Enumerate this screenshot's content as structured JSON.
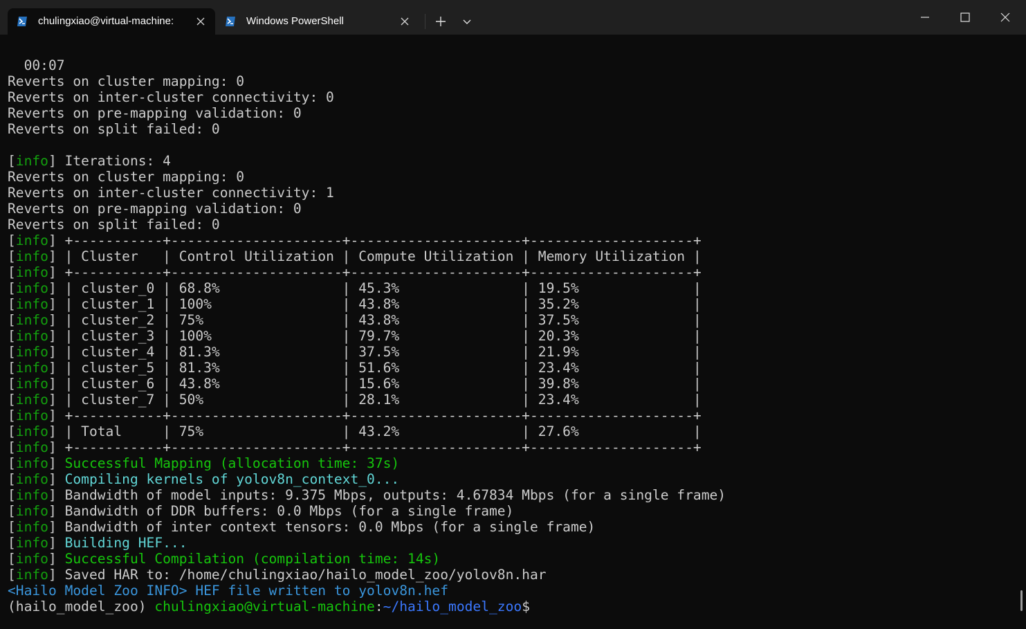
{
  "tabs": [
    {
      "title": "chulingxiao@virtual-machine:"
    },
    {
      "title": "Windows PowerShell"
    }
  ],
  "icons": {
    "tab_icon": "powershell-icon",
    "tab_close": "close-icon",
    "new_tab": "plus-icon",
    "dropdown": "chevron-down-icon",
    "minimize": "minimize-icon",
    "maximize": "maximize-icon",
    "close_window": "close-icon"
  },
  "colors": {
    "background": "#0c0c0c",
    "titlebar": "#202020",
    "info_tag": "#13a10e",
    "success": "#16c60c",
    "cyan": "#61d6d6",
    "blue": "#3b78ff"
  },
  "terminal": {
    "lines": [
      [
        {
          "t": "  00:07"
        }
      ],
      [
        {
          "t": "Reverts on cluster mapping: 0"
        }
      ],
      [
        {
          "t": "Reverts on inter-cluster connectivity: 0"
        }
      ],
      [
        {
          "t": "Reverts on pre-mapping validation: 0"
        }
      ],
      [
        {
          "t": "Reverts on split failed: 0"
        }
      ],
      [
        {
          "t": ""
        }
      ],
      [
        {
          "t": "["
        },
        {
          "t": "info",
          "c": "g"
        },
        {
          "t": "] Iterations: 4"
        }
      ],
      [
        {
          "t": "Reverts on cluster mapping: 0"
        }
      ],
      [
        {
          "t": "Reverts on inter-cluster connectivity: 1"
        }
      ],
      [
        {
          "t": "Reverts on pre-mapping validation: 0"
        }
      ],
      [
        {
          "t": "Reverts on split failed: 0"
        }
      ],
      [
        {
          "t": "["
        },
        {
          "t": "info",
          "c": "g"
        },
        {
          "t": "] +-----------+---------------------+---------------------+--------------------+"
        }
      ],
      [
        {
          "t": "["
        },
        {
          "t": "info",
          "c": "g"
        },
        {
          "t": "] | Cluster   | Control Utilization | Compute Utilization | Memory Utilization |"
        }
      ],
      [
        {
          "t": "["
        },
        {
          "t": "info",
          "c": "g"
        },
        {
          "t": "] +-----------+---------------------+---------------------+--------------------+"
        }
      ],
      [
        {
          "t": "["
        },
        {
          "t": "info",
          "c": "g"
        },
        {
          "t": "] | cluster_0 | 68.8%               | 45.3%               | 19.5%              |"
        }
      ],
      [
        {
          "t": "["
        },
        {
          "t": "info",
          "c": "g"
        },
        {
          "t": "] | cluster_1 | 100%                | 43.8%               | 35.2%              |"
        }
      ],
      [
        {
          "t": "["
        },
        {
          "t": "info",
          "c": "g"
        },
        {
          "t": "] | cluster_2 | 75%                 | 43.8%               | 37.5%              |"
        }
      ],
      [
        {
          "t": "["
        },
        {
          "t": "info",
          "c": "g"
        },
        {
          "t": "] | cluster_3 | 100%                | 79.7%               | 20.3%              |"
        }
      ],
      [
        {
          "t": "["
        },
        {
          "t": "info",
          "c": "g"
        },
        {
          "t": "] | cluster_4 | 81.3%               | 37.5%               | 21.9%              |"
        }
      ],
      [
        {
          "t": "["
        },
        {
          "t": "info",
          "c": "g"
        },
        {
          "t": "] | cluster_5 | 81.3%               | 51.6%               | 23.4%              |"
        }
      ],
      [
        {
          "t": "["
        },
        {
          "t": "info",
          "c": "g"
        },
        {
          "t": "] | cluster_6 | 43.8%               | 15.6%               | 39.8%              |"
        }
      ],
      [
        {
          "t": "["
        },
        {
          "t": "info",
          "c": "g"
        },
        {
          "t": "] | cluster_7 | 50%                 | 28.1%               | 23.4%              |"
        }
      ],
      [
        {
          "t": "["
        },
        {
          "t": "info",
          "c": "g"
        },
        {
          "t": "] +-----------+---------------------+---------------------+--------------------+"
        }
      ],
      [
        {
          "t": "["
        },
        {
          "t": "info",
          "c": "g"
        },
        {
          "t": "] | Total     | 75%                 | 43.2%               | 27.6%              |"
        }
      ],
      [
        {
          "t": "["
        },
        {
          "t": "info",
          "c": "g"
        },
        {
          "t": "] +-----------+---------------------+---------------------+--------------------+"
        }
      ],
      [
        {
          "t": "["
        },
        {
          "t": "info",
          "c": "g"
        },
        {
          "t": "] "
        },
        {
          "t": "Successful Mapping (allocation time: 37s)",
          "c": "bg"
        }
      ],
      [
        {
          "t": "["
        },
        {
          "t": "info",
          "c": "g"
        },
        {
          "t": "] "
        },
        {
          "t": "Compiling kernels of yolov8n_context_0...",
          "c": "cy"
        }
      ],
      [
        {
          "t": "["
        },
        {
          "t": "info",
          "c": "g"
        },
        {
          "t": "] Bandwidth of model inputs: 9.375 Mbps, outputs: 4.67834 Mbps (for a single frame)"
        }
      ],
      [
        {
          "t": "["
        },
        {
          "t": "info",
          "c": "g"
        },
        {
          "t": "] Bandwidth of DDR buffers: 0.0 Mbps (for a single frame)"
        }
      ],
      [
        {
          "t": "["
        },
        {
          "t": "info",
          "c": "g"
        },
        {
          "t": "] Bandwidth of inter context tensors: 0.0 Mbps (for a single frame)"
        }
      ],
      [
        {
          "t": "["
        },
        {
          "t": "info",
          "c": "g"
        },
        {
          "t": "] "
        },
        {
          "t": "Building HEF...",
          "c": "cy"
        }
      ],
      [
        {
          "t": "["
        },
        {
          "t": "info",
          "c": "g"
        },
        {
          "t": "] "
        },
        {
          "t": "Successful Compilation (compilation time: 14s)",
          "c": "bg"
        }
      ],
      [
        {
          "t": "["
        },
        {
          "t": "info",
          "c": "g"
        },
        {
          "t": "] Saved HAR to: /home/chulingxiao/hailo_model_zoo/yolov8n.har"
        }
      ],
      [
        {
          "t": "<Hailo Model Zoo INFO> HEF file written to yolov8n.hef",
          "c": "c"
        }
      ],
      [
        {
          "t": "(hailo_model_zoo) "
        },
        {
          "t": "chulingxiao@virtual-machine",
          "c": "bg"
        },
        {
          "t": ":"
        },
        {
          "t": "~/hailo_model_zoo",
          "c": "b"
        },
        {
          "t": "$"
        }
      ]
    ]
  }
}
